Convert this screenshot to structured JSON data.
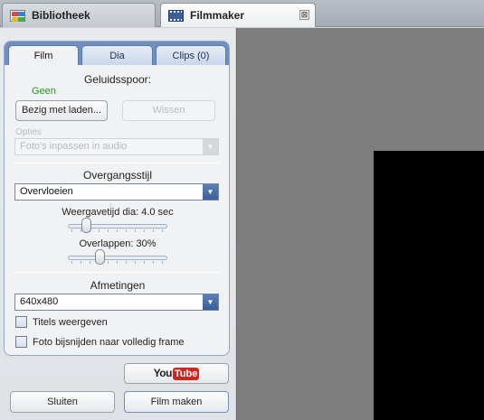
{
  "tabs": [
    {
      "label": "Bibliotheek",
      "icon": "library-icon",
      "active": false
    },
    {
      "label": "Filmmaker",
      "icon": "filmstrip-icon",
      "active": true,
      "close_glyph": "⊠"
    }
  ],
  "panel": {
    "tabs": [
      {
        "label": "Film",
        "active": true
      },
      {
        "label": "Dia",
        "active": false
      },
      {
        "label": "Clips (0)",
        "active": false
      }
    ],
    "soundtrack": {
      "heading": "Geluidsspoor:",
      "value": "Geen",
      "value_color": "#2f8f2f",
      "load_button": "Bezig met laden...",
      "clear_button": "Wissen",
      "options_label": "Opties",
      "options_value": "Foto's inpassen in audio"
    },
    "transition": {
      "heading": "Overgangsstijl",
      "style_value": "Overvloeien",
      "duration_label": "Weergavetijd dia: 4.0 sec",
      "duration_fraction": 0.15,
      "overlap_label": "Overlappen: 30%",
      "overlap_fraction": 0.3
    },
    "dimensions": {
      "heading": "Afmetingen",
      "value": "640x480",
      "show_titles_label": "Titels weergeven",
      "show_titles_checked": false,
      "crop_label": "Foto bijsnijden naar volledig frame",
      "crop_checked": false
    }
  },
  "footer": {
    "youtube_you": "You",
    "youtube_tube": "Tube",
    "close_button": "Sluiten",
    "make_movie_button": "Film maken"
  },
  "colors": {
    "accent": "#6f8fbf",
    "dropdown_arrow": "#4a6cab",
    "preview_bg": "#7e7e7e",
    "video_bg": "#000000",
    "youtube_red": "#d0261e"
  }
}
